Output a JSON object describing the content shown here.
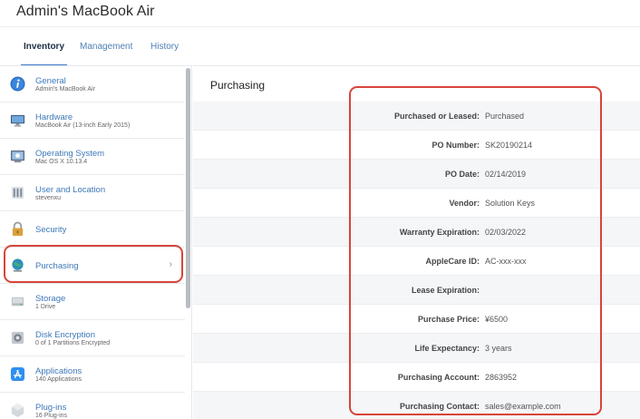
{
  "header": {
    "title": "Admin's MacBook Air"
  },
  "tabs": [
    {
      "label": "Inventory",
      "active": true
    },
    {
      "label": "Management",
      "active": false
    },
    {
      "label": "History",
      "active": false
    }
  ],
  "sidebar": {
    "items": [
      {
        "label": "General",
        "sub": "Admin's MacBook Air",
        "icon": "info-icon"
      },
      {
        "label": "Hardware",
        "sub": "MacBook Air (13-inch Early 2015)",
        "icon": "monitor-icon"
      },
      {
        "label": "Operating System",
        "sub": "Mac OS X 10.13.4",
        "icon": "os-icon"
      },
      {
        "label": "User and Location",
        "sub": "stevenxu",
        "icon": "user-location-icon"
      },
      {
        "label": "Security",
        "sub": "",
        "icon": "lock-icon"
      },
      {
        "label": "Purchasing",
        "sub": "",
        "icon": "globe-icon",
        "selected": true,
        "chevron": "›"
      },
      {
        "label": "Storage",
        "sub": "1 Drive",
        "icon": "drive-icon"
      },
      {
        "label": "Disk Encryption",
        "sub": "0 of 1 Partitions Encrypted",
        "icon": "safe-icon"
      },
      {
        "label": "Applications",
        "sub": "140 Applications",
        "icon": "app-store-icon"
      },
      {
        "label": "Plug-ins",
        "sub": "16 Plug-ins",
        "icon": "plugin-icon"
      }
    ]
  },
  "main": {
    "title": "Purchasing",
    "fields": [
      {
        "label": "Purchased or Leased:",
        "value": "Purchased"
      },
      {
        "label": "PO Number:",
        "value": "SK20190214"
      },
      {
        "label": "PO Date:",
        "value": "02/14/2019"
      },
      {
        "label": "Vendor:",
        "value": "Solution Keys"
      },
      {
        "label": "Warranty Expiration:",
        "value": "02/03/2022"
      },
      {
        "label": "AppleCare ID:",
        "value": "AC-xxx-xxx"
      },
      {
        "label": "Lease Expiration:",
        "value": ""
      },
      {
        "label": "Purchase Price:",
        "value": "¥6500"
      },
      {
        "label": "Life Expectancy:",
        "value": "3 years"
      },
      {
        "label": "Purchasing Account:",
        "value": "2863952"
      },
      {
        "label": "Purchasing Contact:",
        "value": "sales@example.com"
      }
    ]
  },
  "colors": {
    "accent": "#3d78b8",
    "highlight": "#d9443a"
  }
}
